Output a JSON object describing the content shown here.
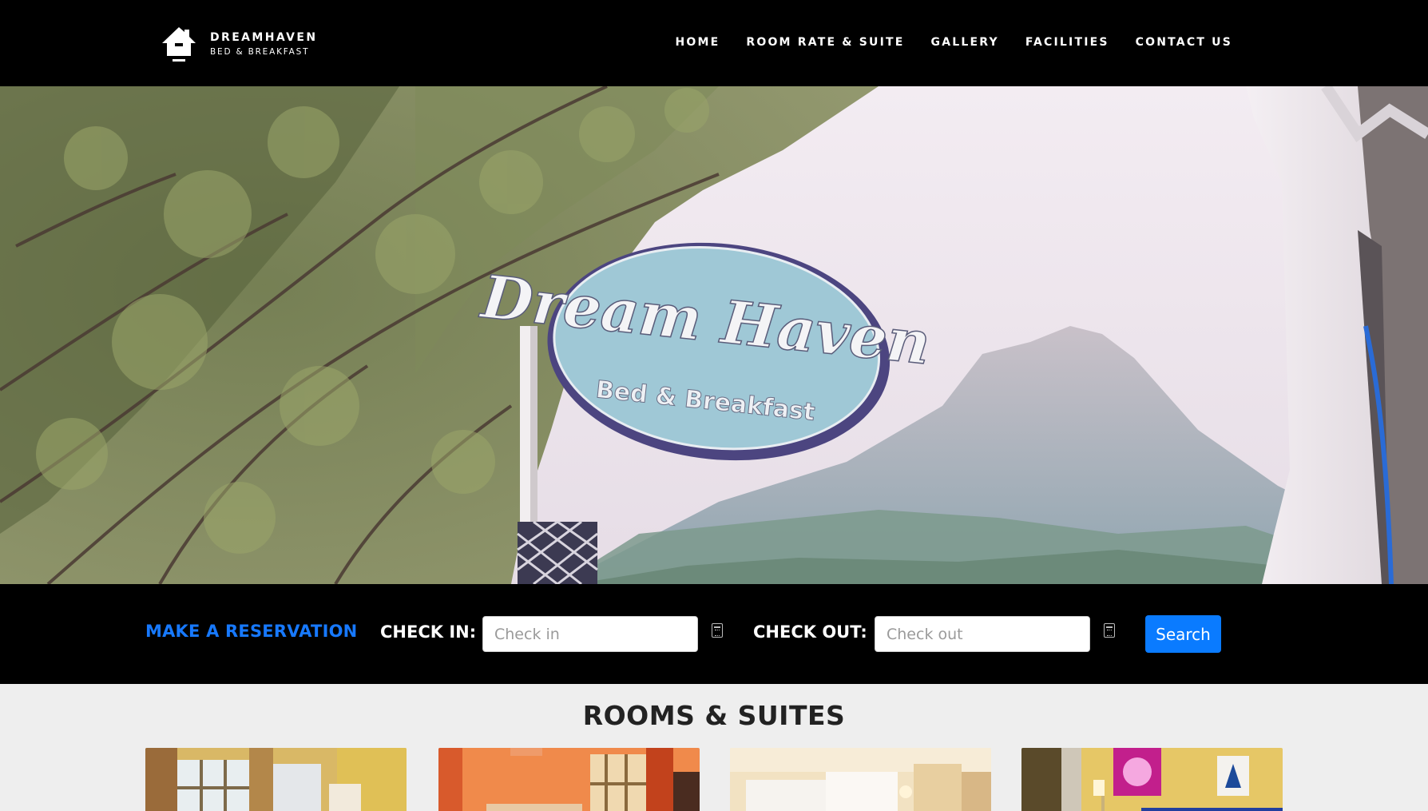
{
  "brand": {
    "name": "DREAMHAVEN",
    "subtitle": "BED & BREAKFAST",
    "icon": "house-icon"
  },
  "nav": {
    "items": [
      "HOME",
      "ROOM RATE & SUITE",
      "GALLERY",
      "FACILITIES",
      "CONTACT US"
    ]
  },
  "hero": {
    "sign_title": "Dream Haven",
    "sign_subtitle": "Bed & Breakfast"
  },
  "reservation": {
    "title": "MAKE A RESERVATION",
    "check_in_label": "CHECK IN:",
    "check_in_placeholder": "Check in",
    "check_out_label": "CHECK OUT:",
    "check_out_placeholder": "Check out",
    "calendar_icon": "calendar-icon",
    "search_label": "Search",
    "accent_color": "#1779ff",
    "button_color": "#0a7bff"
  },
  "rooms": {
    "title": "ROOMS & SUITES"
  }
}
